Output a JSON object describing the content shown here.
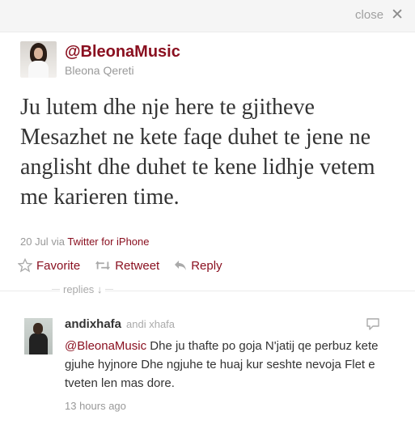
{
  "header": {
    "close_label": "close",
    "close_icon": "close-icon"
  },
  "tweet": {
    "screen_name": "@BleonaMusic",
    "real_name": "Bleona Qereti",
    "text": "Ju lutem dhe nje here te gjitheve Mesazhet ne kete faqe duhet te jene ne anglisht dhe duhet te kene lidhje vetem me karieren time.",
    "date": "20 Jul",
    "via_prefix": "via",
    "via_source": "Twitter for iPhone"
  },
  "actions": {
    "favorite_label": "Favorite",
    "retweet_label": "Retweet",
    "reply_label": "Reply"
  },
  "replies": {
    "header_label": "replies ↓",
    "items": [
      {
        "screen_name": "andixhafa",
        "real_name": "andi xhafa",
        "mention": "@BleonaMusic",
        "text": " Dhe ju thafte po goja N'jatij qe perbuz kete gjuhe hyjnore Dhe ngjuhe te huaj kur seshte nevoja Flet e tveten len mas dore.",
        "time": "13 hours ago"
      }
    ]
  },
  "colors": {
    "link": "#8a1020",
    "muted": "#999999",
    "text": "#333333"
  }
}
